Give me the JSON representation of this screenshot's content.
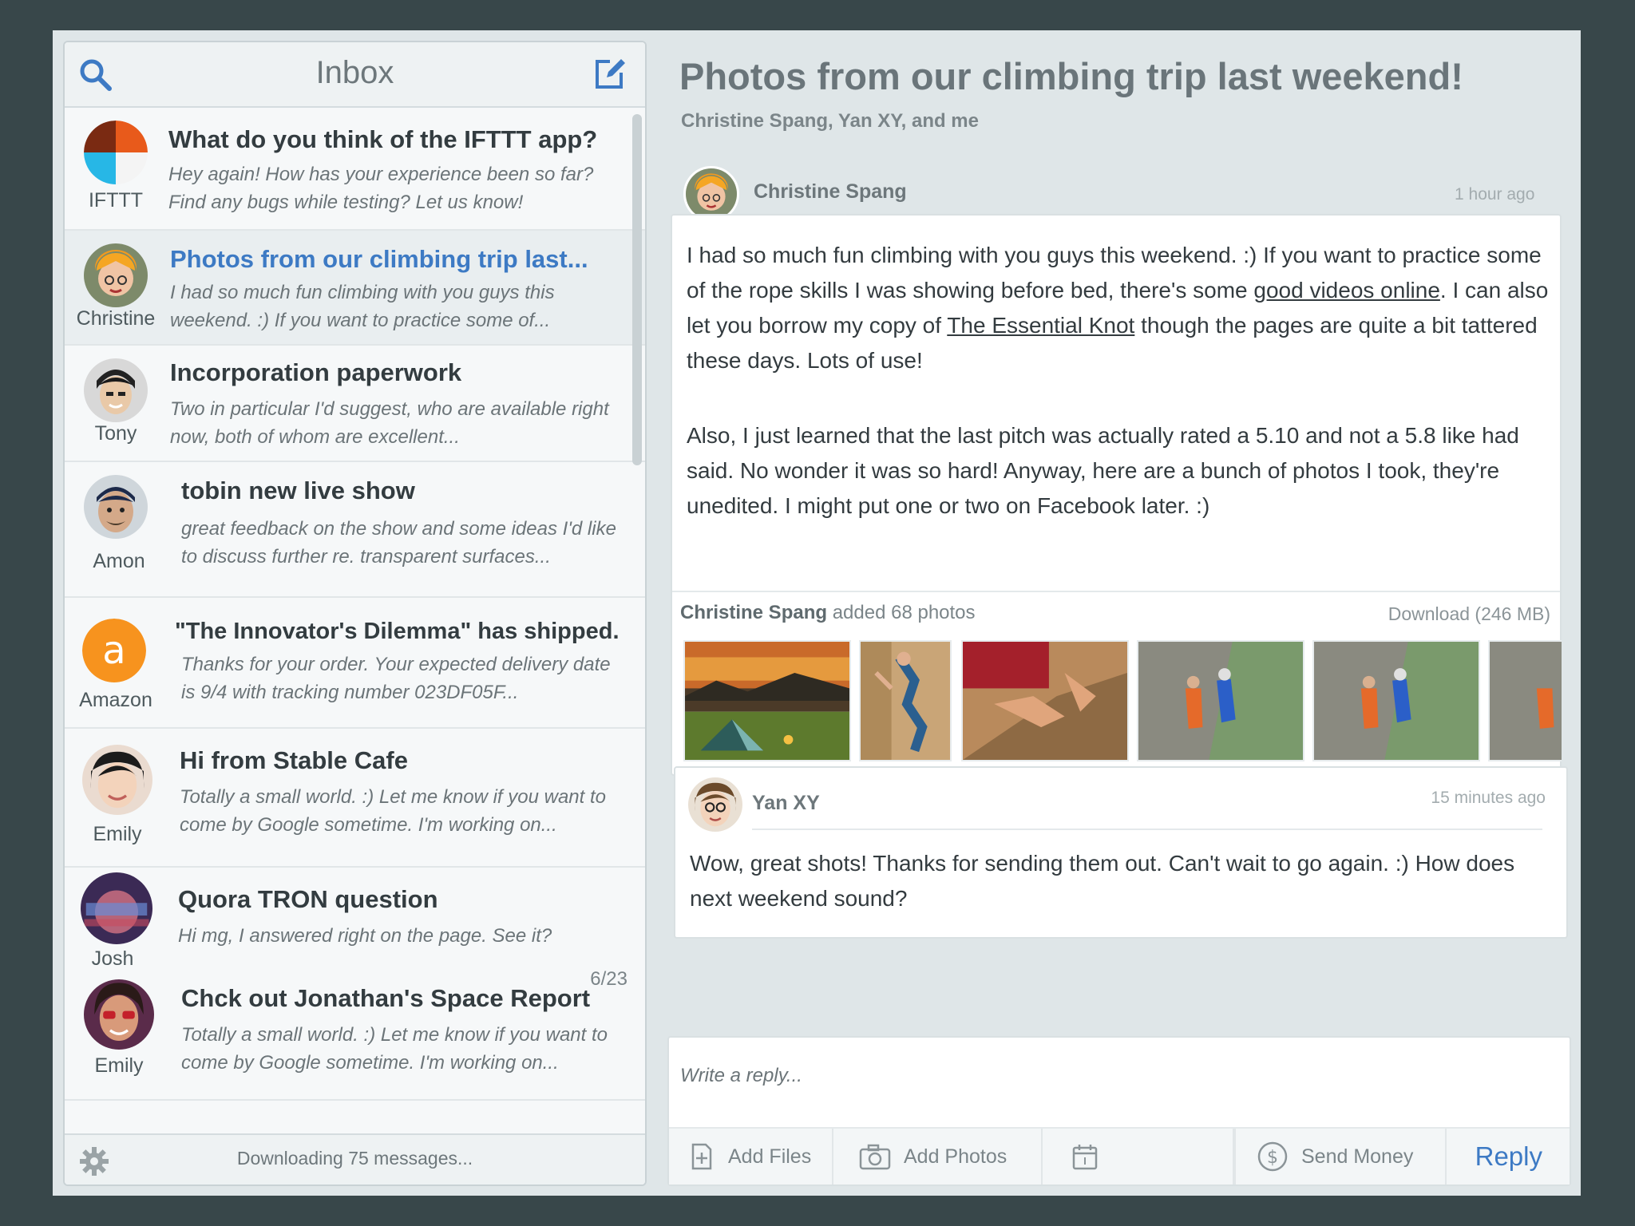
{
  "sidebar": {
    "title": "Inbox",
    "status": "Downloading 75 messages...",
    "items": [
      {
        "sender": "IFTTT",
        "subject": "What do you think of the IFTTT app?",
        "preview": "Hey again! How has your experience been so far? Find any bugs while testing? Let us know!"
      },
      {
        "sender": "Christine",
        "subject": "Photos from our climbing trip last...",
        "preview": "I had so much fun climbing with you guys this weekend. :) If you want to practice some of..."
      },
      {
        "sender": "Tony",
        "subject": "Incorporation paperwork",
        "preview": "Two in particular I'd suggest, who are available right now, both of whom are excellent..."
      },
      {
        "sender": "Amon",
        "subject": "tobin new live show",
        "preview": "great feedback on the show and some ideas I'd like to discuss further re. transparent surfaces..."
      },
      {
        "sender": "Amazon",
        "subject": "\"The Innovator's Dilemma\" has shipped.",
        "preview": "Thanks for your order. Your expected delivery date is 9/4 with tracking number 023DF05F..."
      },
      {
        "sender": "Emily",
        "subject": "Hi from Stable Cafe",
        "preview": "Totally a small world. :) Let me know if you want to come by Google sometime. I'm working on..."
      },
      {
        "sender": "Josh",
        "subject": "Quora TRON question",
        "preview": "Hi mg, I answered right on the page. See it?"
      },
      {
        "sender": "Emily",
        "subject": "Chck out Jonathan's Space Report",
        "preview": "Totally a small world. :) Let me know if you want to come by Google sometime. I'm working on...",
        "date": "6/23"
      }
    ]
  },
  "thread": {
    "title": "Photos from our climbing trip last weekend!",
    "participants": "Christine Spang, Yan XY, and me",
    "messages": [
      {
        "name": "Christine Spang",
        "time": "1 hour ago",
        "p1a": "I had so much fun climbing with you guys this weekend. :) If you want to practice some of the rope skills I was showing before bed, there's some ",
        "link1": "good videos online",
        "p1b": ". I can also let you borrow my copy of ",
        "link2": "The Essential Knot",
        "p1c": " though the pages are quite a bit tattered these days. Lots of use!",
        "p2": "Also, I just learned that the last pitch was actually rated a 5.10 and not a 5.8 like had said. No wonder it was so hard! Anyway, here are a bunch of photos I took, they're unedited. I might put one or two on Facebook later. :)",
        "attach_sender": "Christine Spang",
        "attach_text": " added 68 photos",
        "download": "Download (246 MB)"
      },
      {
        "name": "Yan XY",
        "time": "15 minutes ago",
        "body": "Wow, great shots! Thanks for sending them out. Can't wait to go again. :) How does next weekend sound?"
      }
    ]
  },
  "reply": {
    "placeholder": "Write a reply...",
    "add_files": "Add Files",
    "add_photos": "Add Photos",
    "send_money": "Send Money",
    "reply_label": "Reply"
  },
  "colors": {
    "accent": "#3d7ac4",
    "background": "#38474a",
    "panel": "#dfe6e8"
  }
}
